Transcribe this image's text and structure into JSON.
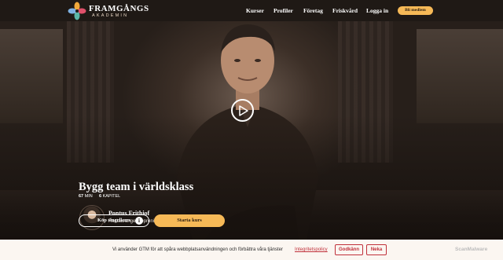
{
  "header": {
    "brand": "FRAMGÅNGS",
    "brand_sub": "AKADEMIN",
    "nav": [
      {
        "label": "Kurser"
      },
      {
        "label": "Profiler"
      },
      {
        "label": "Företag"
      },
      {
        "label": "Friskvård"
      },
      {
        "label": "Logga in"
      }
    ],
    "member_button": "Bli medlem"
  },
  "course": {
    "title": "Bygg team i världsklass",
    "duration_value": "67",
    "duration_unit": "MIN",
    "chapters_value": "6",
    "chapters_unit": "KAPITEL",
    "instructor_name": "Pontus Frithiof",
    "instructor_role": "Restaurangentreprenör",
    "buy_button": "Köp singelkurs",
    "start_button": "Starta kurs",
    "info_glyph": "i"
  },
  "cookie": {
    "text": "Vi använder GTM för att spåra webbplatsanvändningen och förbättra våra tjänster",
    "link": "Integritetspolicy",
    "accept": "Godkänn",
    "deny": "Neka"
  },
  "watermark": "ScanMalware",
  "colors": {
    "accent": "#f6b957",
    "topbar": "#1f1915",
    "cookie_red": "#c0303a"
  }
}
